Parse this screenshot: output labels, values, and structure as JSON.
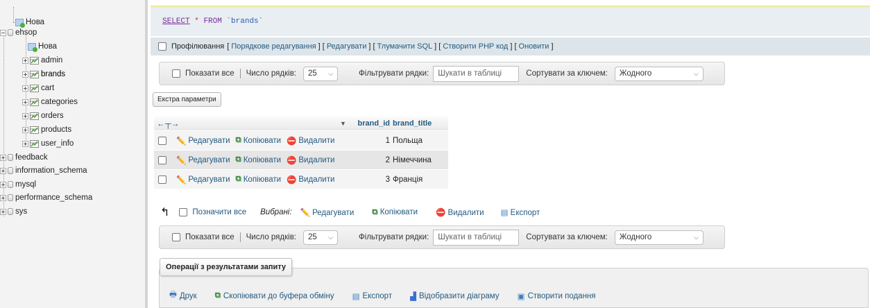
{
  "nav": {
    "items": [
      {
        "label": "Нова",
        "icon": "new-icon",
        "kind": "new"
      },
      {
        "label": "ehsop",
        "icon": "database-icon",
        "kind": "db-open"
      },
      {
        "label": "Нова",
        "icon": "new-icon",
        "kind": "new-child"
      },
      {
        "label": "admin",
        "icon": "table-icon",
        "kind": "table"
      },
      {
        "label": "brands",
        "icon": "table-icon",
        "kind": "table"
      },
      {
        "label": "cart",
        "icon": "table-icon",
        "kind": "table"
      },
      {
        "label": "categories",
        "icon": "table-icon",
        "kind": "table"
      },
      {
        "label": "orders",
        "icon": "table-icon",
        "kind": "table"
      },
      {
        "label": "products",
        "icon": "table-icon",
        "kind": "table"
      },
      {
        "label": "user_info",
        "icon": "table-icon",
        "kind": "table"
      },
      {
        "label": "feedback",
        "icon": "database-icon",
        "kind": "db"
      },
      {
        "label": "information_schema",
        "icon": "database-icon",
        "kind": "db"
      },
      {
        "label": "mysql",
        "icon": "database-icon",
        "kind": "db"
      },
      {
        "label": "performance_schema",
        "icon": "database-icon",
        "kind": "db"
      },
      {
        "label": "sys",
        "icon": "database-icon",
        "kind": "db"
      }
    ]
  },
  "sql": {
    "select": "SELECT",
    "star": "*",
    "from": "FROM",
    "table": "`brands`"
  },
  "profile": {
    "label": "Профілювання",
    "links": [
      "Порядкове редагування",
      "Редагувати",
      "Тлумачити SQL",
      "Створити PHP код",
      "Оновити"
    ]
  },
  "navpanel": {
    "show_all": "Показати все",
    "rows_label": "Число рядків:",
    "rows_value": "25",
    "filter_label": "Фільтрувати рядки:",
    "filter_placeholder": "Шукати в таблиці",
    "sort_label": "Сортувати за ключем:",
    "sort_value": "Жодного"
  },
  "extra_button": "Екстра параметри",
  "table": {
    "col_id": "brand_id",
    "col_title": "brand_title",
    "action_edit": "Редагувати",
    "action_copy": "Копіювати",
    "action_delete": "Видалити",
    "rows": [
      {
        "id": "1",
        "title": "Польща"
      },
      {
        "id": "2",
        "title": "Німеччина"
      },
      {
        "id": "3",
        "title": "Франція"
      }
    ]
  },
  "bulk": {
    "check_all": "Позначити все",
    "with_selected": "Вибрані:",
    "edit": "Редагувати",
    "copy": "Копіювати",
    "delete": "Видалити",
    "export": "Експорт"
  },
  "query_ops": {
    "legend": "Операції з результатами запиту",
    "print": "Друк",
    "copy_clipboard": "Скопіювати до буфера обміну",
    "export": "Експорт",
    "chart": "Відобразити діаграму",
    "create_view": "Створити подання"
  },
  "colors": {
    "link": "#235a81",
    "sql_bg": "#e8eef1",
    "nav_bg": "#f3f3f3"
  }
}
